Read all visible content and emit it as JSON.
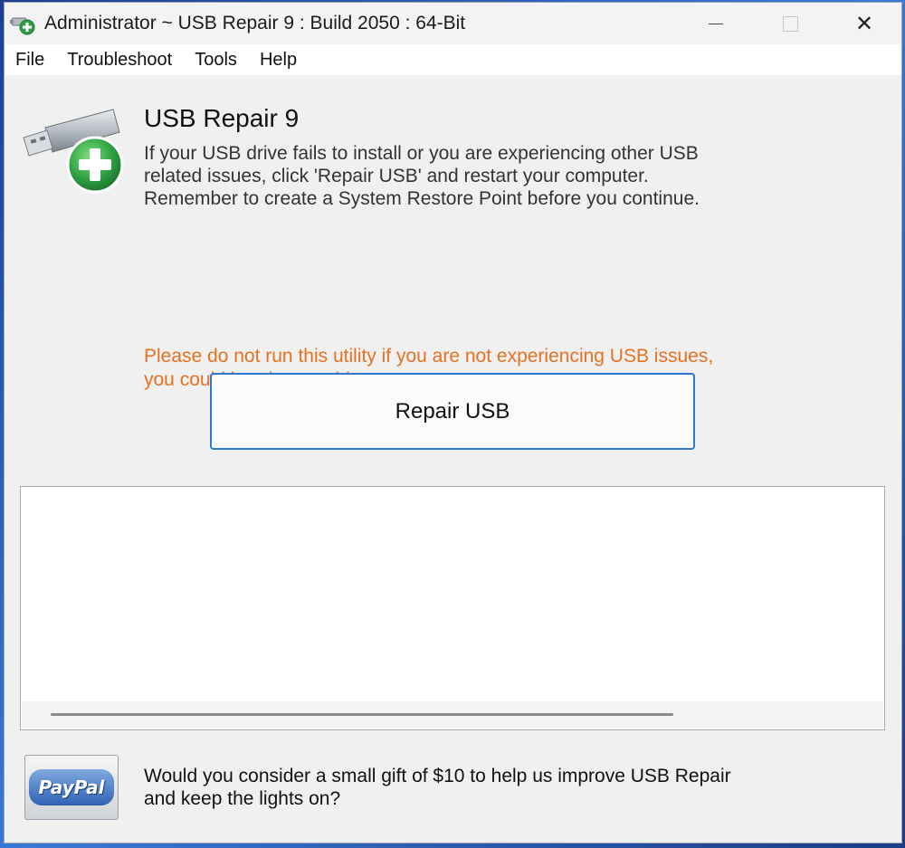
{
  "window": {
    "title": "Administrator ~ USB Repair 9 : Build 2050 : 64-Bit",
    "controls": {
      "minimize": "—",
      "close": "✕"
    }
  },
  "menu": {
    "items": [
      "File",
      "Troubleshoot",
      "Tools",
      "Help"
    ]
  },
  "header": {
    "title": "USB Repair 9",
    "description": "If your USB drive fails to install or you are experiencing other USB\nrelated issues, click 'Repair USB' and restart your computer.\nRemember to create a System Restore Point before you continue.",
    "icon": "usb-drive-add-icon"
  },
  "warning": {
    "text": "Please do not run this utility if you are not experiencing USB issues,\nyou could break something.",
    "color": "#e8701f"
  },
  "actions": {
    "repair_label": "Repair USB"
  },
  "log": {
    "lines": []
  },
  "donate": {
    "paypal_label": "PayPal",
    "text": "Would you consider a small gift of $10 to help us improve USB Repair\nand keep the lights on?"
  },
  "colors": {
    "accent": "#2f77d1",
    "warning": "#e8701f",
    "plus_green": "#2ea043"
  }
}
